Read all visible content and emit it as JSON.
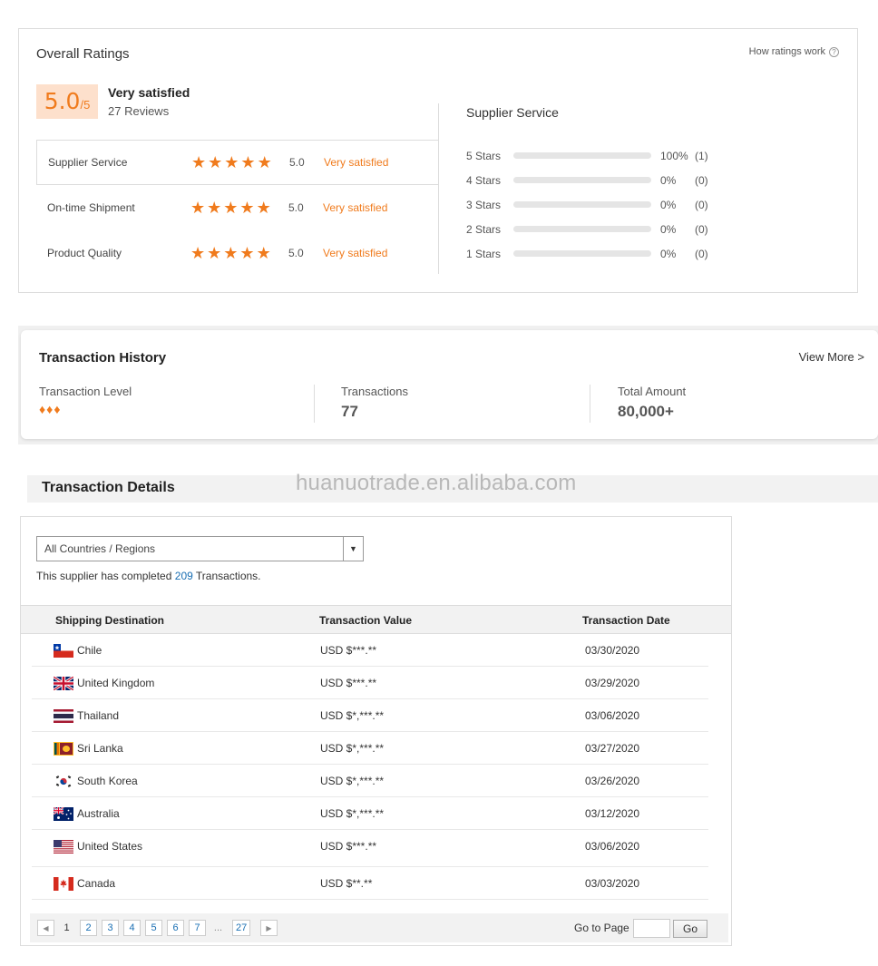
{
  "ratings": {
    "title": "Overall Ratings",
    "how_ratings_work": "How ratings work",
    "score": "5.0",
    "score_denominator": "/5",
    "overall_label": "Very satisfied",
    "reviews": "27 Reviews",
    "categories": [
      {
        "label": "Supplier Service",
        "stars": 5,
        "score": "5.0",
        "desc": "Very satisfied"
      },
      {
        "label": "On-time Shipment",
        "stars": 5,
        "score": "5.0",
        "desc": "Very satisfied"
      },
      {
        "label": "Product Quality",
        "stars": 5,
        "score": "5.0",
        "desc": "Very satisfied"
      }
    ],
    "distribution_title": "Supplier Service",
    "distribution": [
      {
        "label": "5 Stars",
        "fraction": 1.0,
        "percent": "100%",
        "count": "(1)"
      },
      {
        "label": "4 Stars",
        "fraction": 0,
        "percent": "0%",
        "count": "(0)"
      },
      {
        "label": "3 Stars",
        "fraction": 0,
        "percent": "0%",
        "count": "(0)"
      },
      {
        "label": "2 Stars",
        "fraction": 0,
        "percent": "0%",
        "count": "(0)"
      },
      {
        "label": "1 Stars",
        "fraction": 0,
        "percent": "0%",
        "count": "(0)"
      }
    ],
    "accent_color": "#f07b1d"
  },
  "history": {
    "title": "Transaction History",
    "view_more": "View More >",
    "level_label": "Transaction Level",
    "level_diamonds": 3,
    "transactions_label": "Transactions",
    "transactions_value": "77",
    "total_label": "Total Amount",
    "total_value": "80,000+"
  },
  "details": {
    "title": "Transaction Details",
    "watermark": "huanuotrade.en.alibaba.com",
    "region_select": "All Countries / Regions",
    "completed_prefix": "This supplier has completed",
    "completed_count": "209",
    "completed_suffix": "Transactions.",
    "columns": [
      "Shipping Destination",
      "Transaction Value",
      "Transaction Date"
    ],
    "rows": [
      {
        "flag": "chile-flag-icon",
        "country": "Chile",
        "value": "USD $***.**",
        "date": "03/30/2020"
      },
      {
        "flag": "uk-flag-icon",
        "country": "United Kingdom",
        "value": "USD $***.**",
        "date": "03/29/2020"
      },
      {
        "flag": "thailand-flag-icon",
        "country": "Thailand",
        "value": "USD $*,***.**",
        "date": "03/06/2020"
      },
      {
        "flag": "sri-lanka-flag-icon",
        "country": "Sri Lanka",
        "value": "USD $*,***.**",
        "date": "03/27/2020"
      },
      {
        "flag": "south-korea-flag-icon",
        "country": "South Korea",
        "value": "USD $*,***.**",
        "date": "03/26/2020"
      },
      {
        "flag": "australia-flag-icon",
        "country": "Australia",
        "value": "USD $*,***.**",
        "date": "03/12/2020"
      },
      {
        "flag": "us-flag-icon",
        "country": "United States",
        "value": "USD $***.**",
        "date": "03/06/2020"
      },
      {
        "flag": "canada-flag-icon",
        "country": "Canada",
        "value": "USD $**.**",
        "date": "03/03/2020"
      }
    ],
    "pagination": {
      "prev": "◀",
      "current": "1",
      "pages": [
        "2",
        "3",
        "4",
        "5",
        "6",
        "7"
      ],
      "ellipsis": "...",
      "last": "27",
      "next": "▶",
      "goto_label": "Go to Page",
      "go_button": "Go"
    }
  }
}
